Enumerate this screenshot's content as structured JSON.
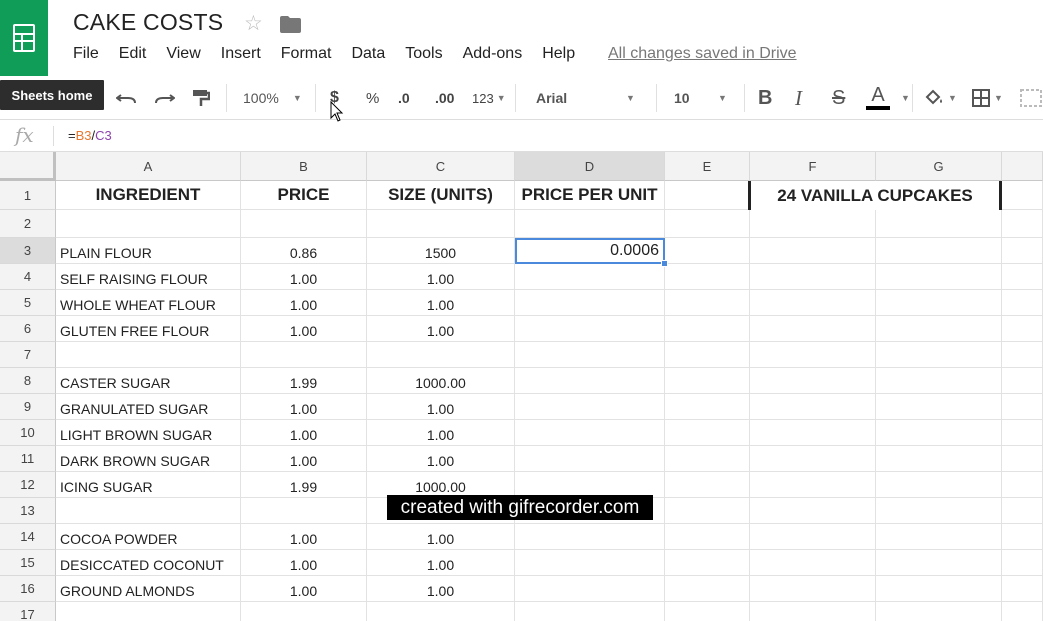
{
  "app": {
    "title": "CAKE COSTS",
    "save_status": "All changes saved in Drive",
    "tooltip": "Sheets home",
    "brand_color": "#0f9d58"
  },
  "menu": [
    "File",
    "Edit",
    "View",
    "Insert",
    "Format",
    "Data",
    "Tools",
    "Add-ons",
    "Help"
  ],
  "toolbar": {
    "zoom": "100%",
    "currency": "$",
    "percent": "%",
    "decrease_decimal": ".0",
    "increase_decimal": ".00",
    "more_formats": "123",
    "font": "Arial",
    "font_size": "10",
    "bold": "B",
    "italic": "I",
    "strikethrough": "S",
    "text_color": "A",
    "icons": [
      "undo-icon",
      "redo-icon",
      "paint-format-icon",
      "fill-color-icon",
      "borders-icon",
      "merge-cells-icon"
    ]
  },
  "formula_bar": {
    "label": "fx",
    "eq": "=",
    "ref1": "B3",
    "op": "/",
    "ref2": "C3"
  },
  "columns": [
    "A",
    "B",
    "C",
    "D",
    "E",
    "F",
    "G"
  ],
  "selected_cell": "D3",
  "merged_header": "24 VANILLA CUPCAKES",
  "watermark": "created with gifrecorder.com",
  "rows": [
    {
      "n": "1",
      "a": "INGREDIENT",
      "b": "PRICE",
      "c": "SIZE (UNITS)",
      "d": "PRICE PER UNIT"
    },
    {
      "n": "2",
      "a": "",
      "b": "",
      "c": "",
      "d": ""
    },
    {
      "n": "3",
      "a": "PLAIN FLOUR",
      "b": "0.86",
      "c": "1500",
      "d": "0.0006"
    },
    {
      "n": "4",
      "a": "SELF RAISING FLOUR",
      "b": "1.00",
      "c": "1.00",
      "d": ""
    },
    {
      "n": "5",
      "a": "WHOLE WHEAT FLOUR",
      "b": "1.00",
      "c": "1.00",
      "d": ""
    },
    {
      "n": "6",
      "a": "GLUTEN FREE FLOUR",
      "b": "1.00",
      "c": "1.00",
      "d": ""
    },
    {
      "n": "7",
      "a": "",
      "b": "",
      "c": "",
      "d": ""
    },
    {
      "n": "8",
      "a": "CASTER SUGAR",
      "b": "1.99",
      "c": "1000.00",
      "d": ""
    },
    {
      "n": "9",
      "a": "GRANULATED SUGAR",
      "b": "1.00",
      "c": "1.00",
      "d": ""
    },
    {
      "n": "10",
      "a": "LIGHT BROWN SUGAR",
      "b": "1.00",
      "c": "1.00",
      "d": ""
    },
    {
      "n": "11",
      "a": "DARK BROWN SUGAR",
      "b": "1.00",
      "c": "1.00",
      "d": ""
    },
    {
      "n": "12",
      "a": "ICING SUGAR",
      "b": "1.99",
      "c": "1000.00",
      "d": ""
    },
    {
      "n": "13",
      "a": "",
      "b": "",
      "c": "",
      "d": ""
    },
    {
      "n": "14",
      "a": "COCOA POWDER",
      "b": "1.00",
      "c": "1.00",
      "d": ""
    },
    {
      "n": "15",
      "a": "DESICCATED COCONUT",
      "b": "1.00",
      "c": "1.00",
      "d": ""
    },
    {
      "n": "16",
      "a": "GROUND ALMONDS",
      "b": "1.00",
      "c": "1.00",
      "d": ""
    },
    {
      "n": "17",
      "a": "",
      "b": "",
      "c": "",
      "d": ""
    }
  ]
}
